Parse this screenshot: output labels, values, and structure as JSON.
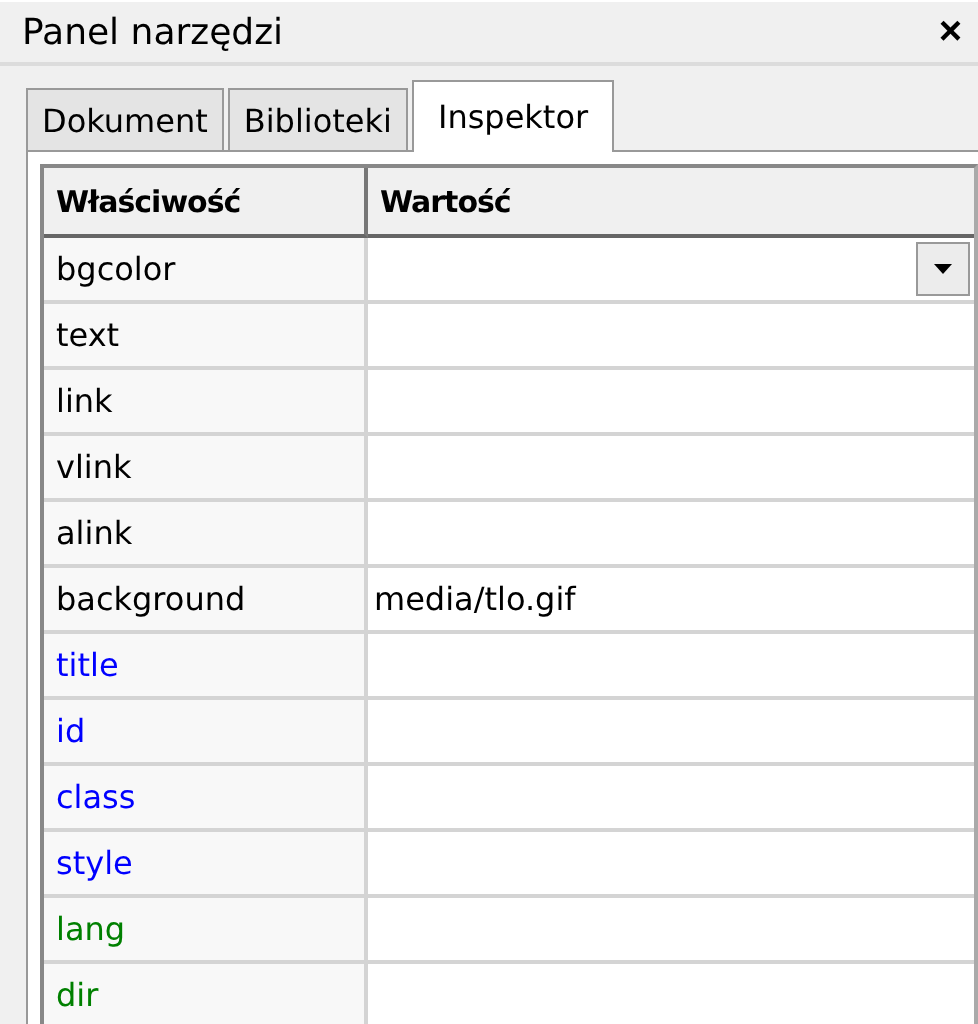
{
  "panel": {
    "title": "Panel narzędzi",
    "close": "×"
  },
  "tabs": [
    {
      "label": "Dokument",
      "selected": false
    },
    {
      "label": "Biblioteki",
      "selected": false
    },
    {
      "label": "Inspektor",
      "selected": true
    }
  ],
  "table": {
    "columns": [
      "Właściwość",
      "Wartość"
    ],
    "rows": [
      {
        "property": "bgcolor",
        "kind": "dropdown",
        "color": "#000000"
      },
      {
        "property": "text",
        "kind": "text",
        "color": "#000000"
      },
      {
        "property": "link",
        "kind": "text",
        "color": "#000000"
      },
      {
        "property": "vlink",
        "kind": "text",
        "color": "#000000"
      },
      {
        "property": "alink",
        "kind": "text",
        "color": "#000000"
      },
      {
        "property": "background",
        "value": "media/tlo.gif",
        "kind": "text",
        "color": "#000000"
      },
      {
        "property": "title",
        "kind": "text",
        "color": "#0000ff"
      },
      {
        "property": "id",
        "kind": "text",
        "color": "#0000ff"
      },
      {
        "property": "class",
        "kind": "text",
        "color": "#0000ff"
      },
      {
        "property": "style",
        "kind": "text",
        "color": "#0000ff"
      },
      {
        "property": "lang",
        "kind": "text",
        "color": "#008000"
      },
      {
        "property": "dir",
        "kind": "text",
        "color": "#008000"
      }
    ]
  }
}
